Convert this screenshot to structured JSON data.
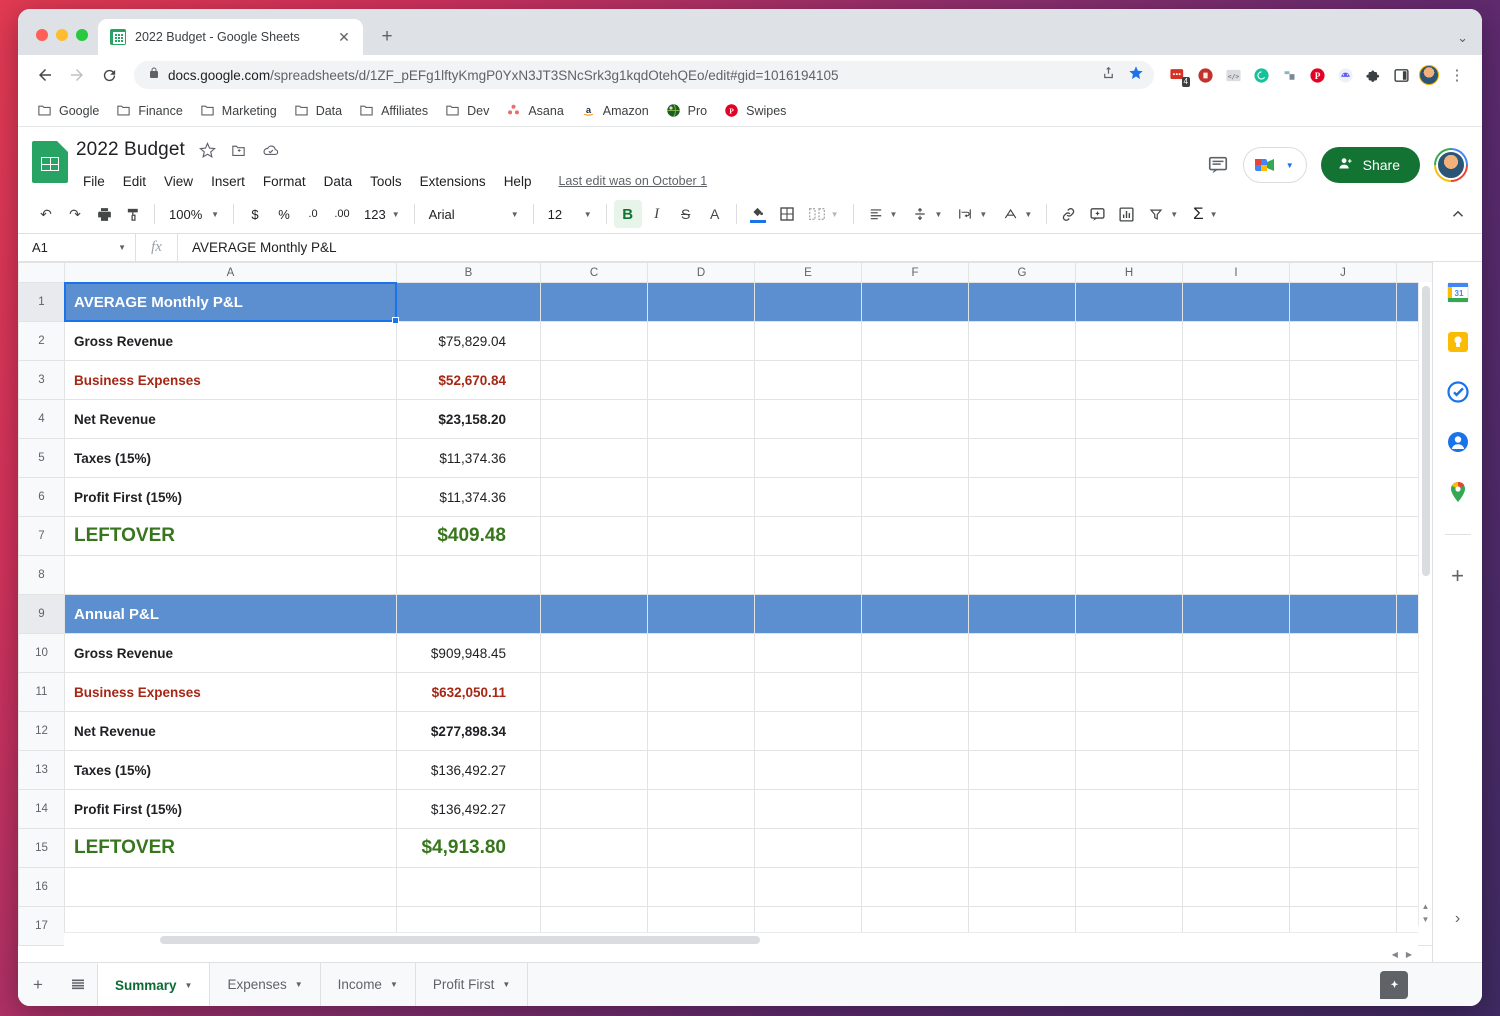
{
  "browser": {
    "tab": {
      "title": "2022 Budget - Google Sheets",
      "close_label": "✕",
      "favicon": "sheets-favicon"
    },
    "new_tab_label": "+",
    "window_menu_label": "⌄",
    "nav": {
      "back": "←",
      "forward": "→",
      "reload": "↻"
    },
    "omnibox": {
      "lock_icon": "lock-icon",
      "url_domain": "docs.google.com",
      "url_path": "/spreadsheets/d/1ZF_pEFg1lftyKmgP0YxN3JT3SNcSrk3g1kqdOtehQEo/edit#gid=1016194105",
      "share_icon": "share-icon",
      "bookmark_icon": "star-icon"
    },
    "extensions": [
      {
        "name": "ext-recorder",
        "badge": "4",
        "color": "#d93025"
      },
      {
        "name": "ext-adblock",
        "color": "#c4302b"
      },
      {
        "name": "ext-code",
        "color": "#9aa0a6"
      },
      {
        "name": "ext-grammarly",
        "color": "#15c39a"
      },
      {
        "name": "ext-notion",
        "color": "#6b7280"
      },
      {
        "name": "ext-pinterest",
        "color": "#e60023"
      },
      {
        "name": "ext-loom",
        "color": "#625df5"
      },
      {
        "name": "ext-puzzle",
        "color": "#3c4043"
      },
      {
        "name": "ext-sidepanel",
        "color": "#3c4043"
      },
      {
        "name": "ext-profile",
        "color": "#f4b400"
      }
    ],
    "menu_icon": "kebab-menu-icon",
    "bookmarks": [
      {
        "label": "Google",
        "icon": "folder-icon"
      },
      {
        "label": "Finance",
        "icon": "folder-icon"
      },
      {
        "label": "Marketing",
        "icon": "folder-icon"
      },
      {
        "label": "Data",
        "icon": "folder-icon"
      },
      {
        "label": "Affiliates",
        "icon": "folder-icon"
      },
      {
        "label": "Dev",
        "icon": "folder-icon"
      },
      {
        "label": "Asana",
        "icon": "asana-icon"
      },
      {
        "label": "Amazon",
        "icon": "amazon-icon"
      },
      {
        "label": "Pro",
        "icon": "globe-icon"
      },
      {
        "label": "Swipes",
        "icon": "pinterest-icon"
      }
    ]
  },
  "sheets": {
    "doc_title": "2022 Budget",
    "title_icons": [
      {
        "name": "star-icon",
        "glyph": "☆"
      },
      {
        "name": "move-to-folder-icon",
        "glyph": "⧉"
      },
      {
        "name": "cloud-saved-icon",
        "glyph": "☁"
      }
    ],
    "menus": [
      "File",
      "Edit",
      "View",
      "Insert",
      "Format",
      "Data",
      "Tools",
      "Extensions",
      "Help"
    ],
    "last_edit": "Last edit was on October 1",
    "comment_icon": "comment-icon",
    "meet_label": "meet-icon",
    "share_label": "Share",
    "avatar_label": "user-avatar",
    "toolbar": {
      "undo": "↶",
      "redo": "↷",
      "print": "⎙",
      "paint_format": "paint-format-icon",
      "zoom": "100%",
      "currency": "$",
      "percent": "%",
      "decrease_decimal": ".0",
      "increase_decimal": ".00",
      "more_formats": "123",
      "font": "Arial",
      "font_size": "12",
      "bold": "B",
      "italic": "I",
      "strikethrough": "S",
      "text_color": "A",
      "fill_color": "fill-color-icon",
      "borders": "borders-icon",
      "merge_cells": "merge-cells-icon",
      "horizontal_align": "align-left-icon",
      "vertical_align": "align-middle-icon",
      "text_wrap": "text-wrap-icon",
      "text_rotation": "text-rotation-icon",
      "insert_link": "link-icon",
      "insert_comment": "insert-comment-icon",
      "insert_chart": "chart-icon",
      "create_filter": "filter-icon",
      "functions": "Σ",
      "collapse": "⌃"
    },
    "formula_bar": {
      "name_box": "A1",
      "fx_label": "fx",
      "formula_value": "AVERAGE Monthly P&L"
    },
    "grid": {
      "columns": [
        "A",
        "B",
        "C",
        "D",
        "E",
        "F",
        "G",
        "H",
        "I",
        "J"
      ],
      "selected_cell": "A1",
      "rows": [
        {
          "n": "1",
          "type": "section",
          "a": "AVERAGE Monthly P&L",
          "b": ""
        },
        {
          "n": "2",
          "type": "normal",
          "a": "Gross Revenue",
          "a_style": "bold",
          "b": "$75,829.04",
          "b_style": ""
        },
        {
          "n": "3",
          "type": "normal",
          "a": "Business Expenses",
          "a_style": "red",
          "b": "$52,670.84",
          "b_style": "red"
        },
        {
          "n": "4",
          "type": "normal",
          "a": "Net Revenue",
          "a_style": "bold",
          "b": "$23,158.20",
          "b_style": "bold"
        },
        {
          "n": "5",
          "type": "normal",
          "a": "Taxes (15%)",
          "a_style": "bold",
          "b": "$11,374.36",
          "b_style": ""
        },
        {
          "n": "6",
          "type": "normal",
          "a": "Profit First (15%)",
          "a_style": "bold",
          "b": "$11,374.36",
          "b_style": ""
        },
        {
          "n": "7",
          "type": "normal",
          "a": "LEFTOVER",
          "a_style": "green-big",
          "b": "$409.48",
          "b_style": "green-big"
        },
        {
          "n": "8",
          "type": "normal",
          "a": "",
          "a_style": "",
          "b": "",
          "b_style": ""
        },
        {
          "n": "9",
          "type": "section",
          "a": "Annual P&L",
          "b": ""
        },
        {
          "n": "10",
          "type": "normal",
          "a": "Gross Revenue",
          "a_style": "bold",
          "b": "$909,948.45",
          "b_style": ""
        },
        {
          "n": "11",
          "type": "normal",
          "a": "Business Expenses",
          "a_style": "red",
          "b": "$632,050.11",
          "b_style": "red"
        },
        {
          "n": "12",
          "type": "normal",
          "a": "Net Revenue",
          "a_style": "bold",
          "b": "$277,898.34",
          "b_style": "bold"
        },
        {
          "n": "13",
          "type": "normal",
          "a": "Taxes (15%)",
          "a_style": "bold",
          "b": "$136,492.27",
          "b_style": ""
        },
        {
          "n": "14",
          "type": "normal",
          "a": "Profit First (15%)",
          "a_style": "bold",
          "b": "$136,492.27",
          "b_style": ""
        },
        {
          "n": "15",
          "type": "normal",
          "a": "LEFTOVER",
          "a_style": "green-big",
          "b": "$4,913.80",
          "b_style": "green-big"
        },
        {
          "n": "16",
          "type": "normal",
          "a": "",
          "a_style": "",
          "b": "",
          "b_style": ""
        },
        {
          "n": "17",
          "type": "normal",
          "a": "",
          "a_style": "",
          "b": "",
          "b_style": ""
        }
      ]
    },
    "side_rail": [
      {
        "name": "google-calendar-icon"
      },
      {
        "name": "google-keep-icon"
      },
      {
        "name": "google-tasks-icon"
      },
      {
        "name": "contacts-icon"
      },
      {
        "name": "google-maps-icon"
      },
      {
        "name": "add-ons-plus-icon"
      }
    ],
    "rail_expand": "›",
    "sheet_tabs": {
      "add_sheet": "+",
      "all_sheets": "all-sheets-icon",
      "tabs": [
        {
          "label": "Summary",
          "active": true
        },
        {
          "label": "Expenses",
          "active": false
        },
        {
          "label": "Income",
          "active": false
        },
        {
          "label": "Profit First",
          "active": false
        }
      ],
      "explore": "explore-icon"
    },
    "colors": {
      "section_header_bg": "#5b8fd0",
      "expense_red": "#a52714",
      "leftover_green": "#38761d",
      "share_green": "#137333",
      "selection_blue": "#1a73e8"
    }
  }
}
